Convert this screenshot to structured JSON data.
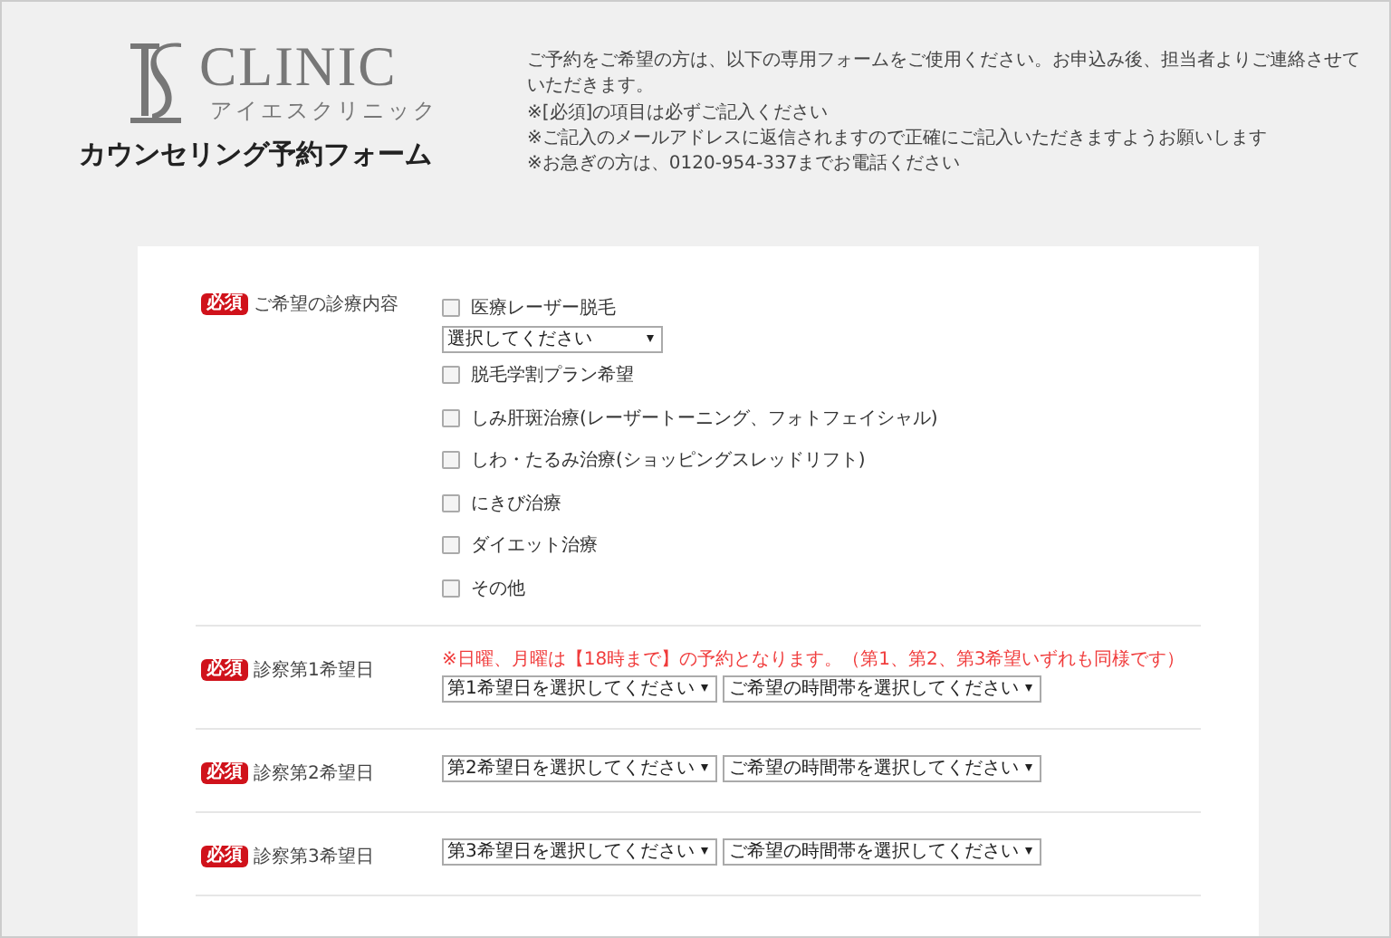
{
  "header": {
    "logo": {
      "name": "CLINIC",
      "subtitle": "アイエスクリニック"
    },
    "title": "カウンセリング予約フォーム",
    "intro": "ご予約をご希望の方は、以下の専用フォームをご使用ください。お申込み後、担当者よりご連絡させていただきます。",
    "notes": [
      "※[必須]の項目は必ずご記入ください",
      "※ご記入のメールアドレスに返信されますので正確にご記入いただきますようお願いします",
      "※お急ぎの方は、0120-954-337までお電話ください"
    ]
  },
  "form": {
    "sections": [
      {
        "required_badge": "必須",
        "label": "ご希望の診療内容",
        "items": [
          {
            "kind": "checkbox",
            "label": "医療レーザー脱毛",
            "checked": false
          },
          {
            "kind": "select",
            "value": "選択してください"
          },
          {
            "kind": "checkbox",
            "label": "脱毛学割プラン希望",
            "checked": false
          },
          {
            "kind": "checkbox",
            "label": "しみ肝斑治療(レーザートーニング、フォトフェイシャル)",
            "checked": false
          },
          {
            "kind": "checkbox",
            "label": "しわ・たるみ治療(ショッピングスレッドリフト)",
            "checked": false
          },
          {
            "kind": "checkbox",
            "label": "にきび治療",
            "checked": false
          },
          {
            "kind": "checkbox",
            "label": "ダイエット治療",
            "checked": false
          },
          {
            "kind": "checkbox",
            "label": "その他",
            "checked": false
          }
        ]
      },
      {
        "required_badge": "必須",
        "label": "診察第1希望日",
        "note": "※日曜、月曜は【18時まで】の予約となります。（第1、第2、第3希望いずれも同様です）",
        "selects": [
          "第1希望日を選択してください",
          "ご希望の時間帯を選択してください"
        ]
      },
      {
        "required_badge": "必須",
        "label": "診察第2希望日",
        "selects": [
          "第2希望日を選択してください",
          "ご希望の時間帯を選択してください"
        ]
      },
      {
        "required_badge": "必須",
        "label": "診察第3希望日",
        "selects": [
          "第3希望日を選択してください",
          "ご希望の時間帯を選択してください"
        ]
      }
    ]
  }
}
